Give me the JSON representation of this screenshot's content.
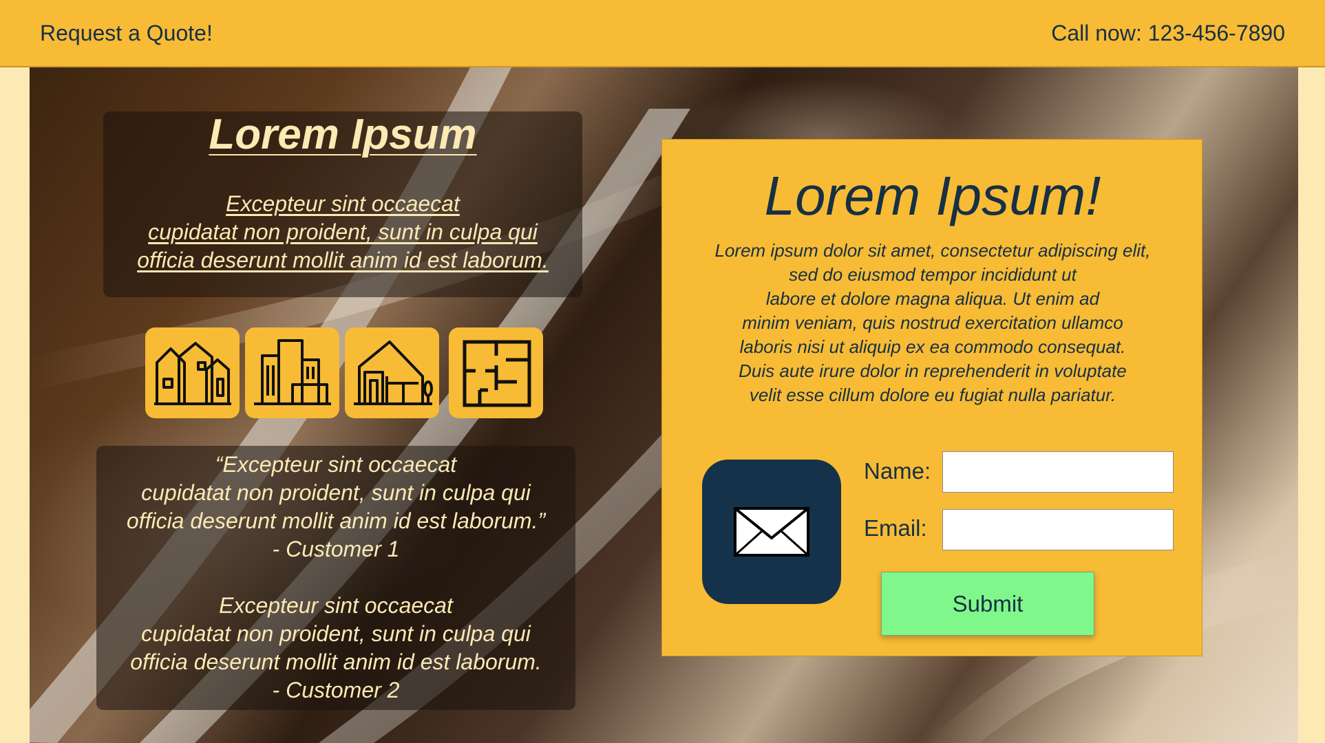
{
  "header": {
    "cta_label": "Request a Quote!",
    "phone_text": "Call now: 123-456-7890"
  },
  "intro": {
    "title": "Lorem Ipsum",
    "lines": [
      "Excepteur sint occaecat",
      "cupidatat non proident, sunt in culpa qui",
      "officia deserunt mollit anim id est laborum."
    ]
  },
  "tiles": [
    {
      "icon": "houses-icon"
    },
    {
      "icon": "buildings-icon"
    },
    {
      "icon": "house-with-tree-icon"
    },
    {
      "icon": "floor-plan-icon"
    }
  ],
  "testimonials": [
    {
      "lines": [
        "“Excepteur sint occaecat",
        "cupidatat non proident, sunt in culpa qui",
        "officia deserunt mollit anim id est laborum.”",
        "- Customer 1"
      ]
    },
    {
      "lines": [
        "Excepteur sint occaecat",
        "cupidatat non proident, sunt in culpa qui",
        "officia deserunt mollit anim id est laborum.",
        "- Customer 2"
      ]
    }
  ],
  "quote_card": {
    "title": "Lorem Ipsum!",
    "body_lines": [
      "Lorem ipsum dolor sit amet, consectetur adipiscing elit,",
      "sed do eiusmod tempor incididunt ut",
      "labore et dolore magna aliqua. Ut enim ad",
      "minim veniam, quis nostrud exercitation ullamco",
      "laboris nisi ut aliquip ex ea commodo consequat.",
      "Duis aute irure dolor in reprehenderit in voluptate",
      "velit esse cillum dolore eu fugiat nulla pariatur."
    ],
    "icon": "envelope-icon",
    "form": {
      "name_label": "Name:",
      "name_value": "",
      "email_label": "Email:",
      "email_value": "",
      "submit_label": "Submit"
    }
  },
  "colors": {
    "accent": "#f8bb35",
    "dark_navy": "#14324a",
    "text_dark": "#163044",
    "text_cream": "#fde9b4",
    "submit_green": "#80f78a"
  }
}
